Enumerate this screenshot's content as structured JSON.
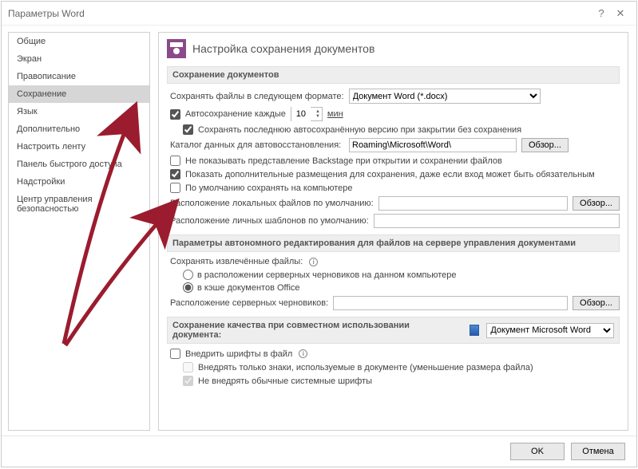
{
  "window": {
    "title": "Параметры Word",
    "help": "?",
    "close": "✕"
  },
  "sidebar": {
    "items": [
      {
        "label": "Общие"
      },
      {
        "label": "Экран"
      },
      {
        "label": "Правописание"
      },
      {
        "label": "Сохранение",
        "selected": true
      },
      {
        "label": "Язык"
      },
      {
        "label": "Дополнительно"
      },
      {
        "label": "Настроить ленту"
      },
      {
        "label": "Панель быстрого доступа"
      },
      {
        "label": "Надстройки"
      },
      {
        "label": "Центр управления безопасностью"
      }
    ]
  },
  "content": {
    "main_heading": "Настройка сохранения документов",
    "save_section_title": "Сохранение документов",
    "format_label": "Сохранять файлы в следующем формате:",
    "format_value": "Документ Word (*.docx)",
    "autosave_label": "Автосохранение каждые",
    "autosave_value": "10",
    "autosave_unit": "мин",
    "keep_last_auto": "Сохранять последнюю автосохранённую версию при закрытии без сохранения",
    "autorecover_label": "Каталог данных для автовосстановления:",
    "autorecover_path": "Roaming\\Microsoft\\Word\\",
    "browse": "Обзор...",
    "no_backstage": "Не показывать представление Backstage при открытии и сохранении файлов",
    "show_additional": "Показать дополнительные размещения для сохранения, даже если вход может быть обязательным",
    "save_local_default": "По умолчанию сохранять на компьютере",
    "local_files_label": "Расположение локальных файлов по умолчанию:",
    "local_files_value": "",
    "templates_label": "Расположение личных шаблонов по умолчанию:",
    "templates_value": "",
    "offline_section_title": "Параметры автономного редактирования для файлов на сервере управления документами",
    "save_checked_out_label": "Сохранять извлечённые файлы:",
    "radio_drafts": "в расположении серверных черновиков на данном компьютере",
    "radio_cache": "в кэше документов Office",
    "drafts_label": "Расположение серверных черновиков:",
    "drafts_value": "",
    "fidelity_section_title": "Сохранение качества при совместном использовании документа:",
    "fidelity_doc": "Документ Microsoft Word",
    "embed_fonts": "Внедрить шрифты в файл",
    "embed_chars_only": "Внедрять только знаки, используемые в документе (уменьшение размера файла)",
    "no_system_fonts": "Не внедрять обычные системные шрифты"
  },
  "footer": {
    "ok": "OK",
    "cancel": "Отмена"
  }
}
